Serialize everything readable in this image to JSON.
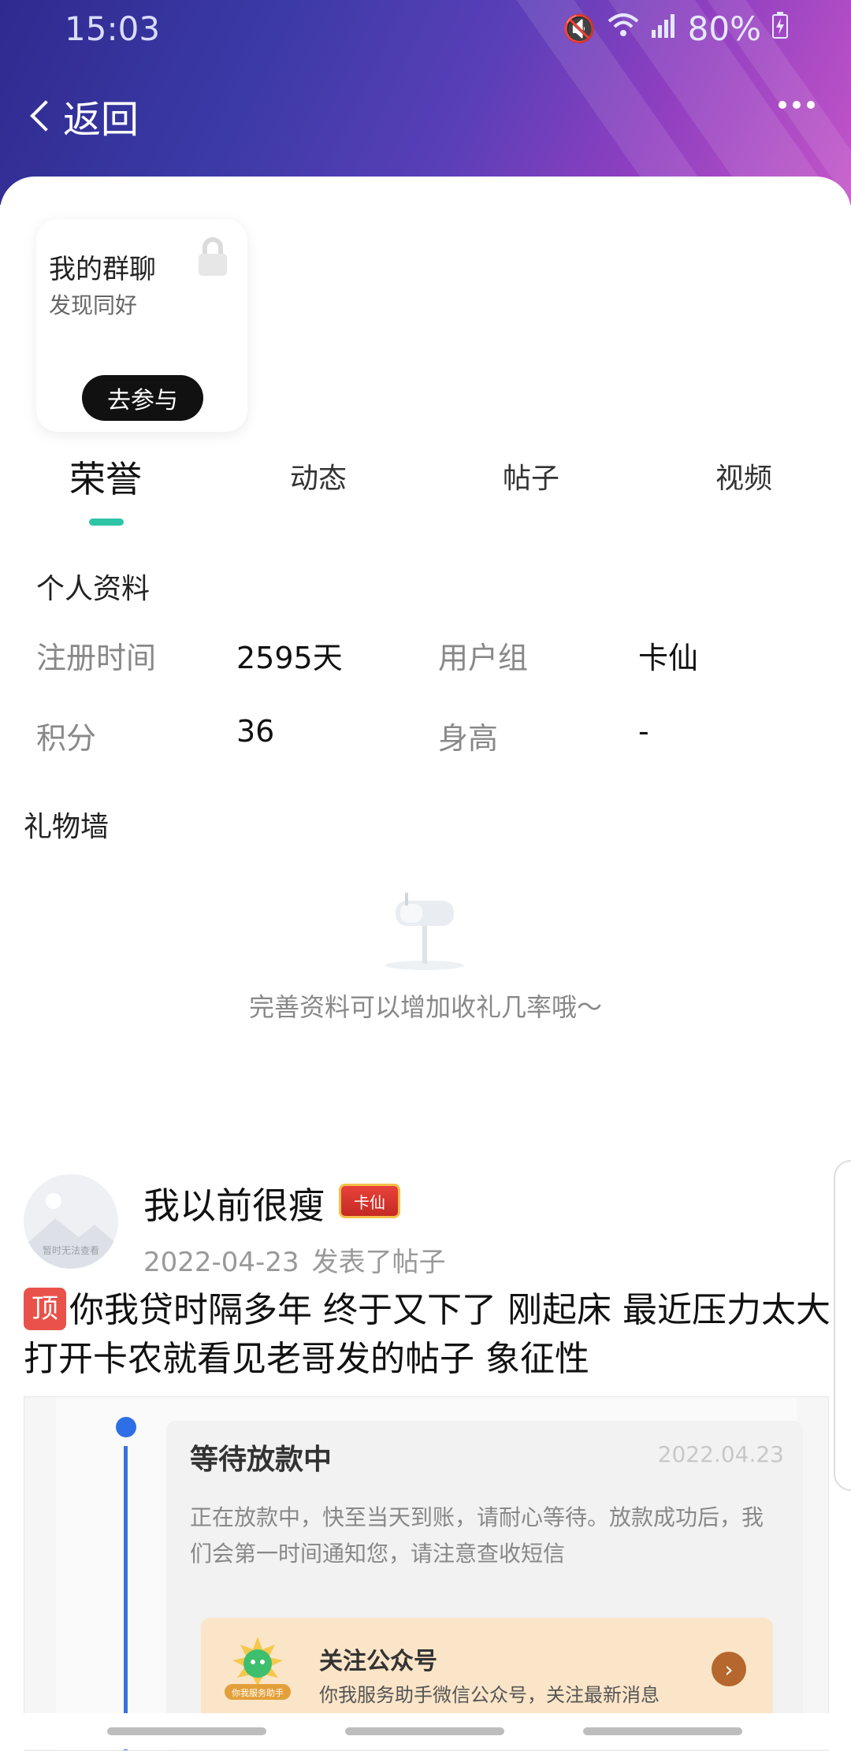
{
  "status_bar": {
    "time": "15:03",
    "battery": "80%",
    "icons": [
      "mute-icon",
      "wifi-icon",
      "signal-icon",
      "battery-charging-icon"
    ]
  },
  "header": {
    "back_label": "返回",
    "more_icon": "more-dots-icon"
  },
  "group_card": {
    "title": "我的群聊",
    "subtitle": "发现同好",
    "button": "去参与",
    "icon": "lock-icon"
  },
  "tabs": [
    {
      "label": "荣誉",
      "active": true
    },
    {
      "label": "动态",
      "active": false
    },
    {
      "label": "帖子",
      "active": false
    },
    {
      "label": "视频",
      "active": false
    }
  ],
  "profile": {
    "title": "个人资料",
    "rows": [
      {
        "label1": "注册时间",
        "value1": "2595天",
        "label2": "用户组",
        "value2": "卡仙"
      },
      {
        "label1": "积分",
        "value1": "36",
        "label2": "身高",
        "value2": "-"
      }
    ]
  },
  "gift_wall": {
    "title": "礼物墙",
    "empty_text": "完善资料可以增加收礼几率哦～",
    "icon": "mailbox-icon"
  },
  "post": {
    "avatar_text": "暂时无法查看",
    "author": "我以前很瘦",
    "badge": "卡仙",
    "date": "2022-04-23",
    "action": "发表了帖子",
    "pin": "顶",
    "text": "你我贷时隔多年 终于又下了 刚起床 最近压力太大 打开卡农就看见老哥发的帖子 象征性",
    "image": {
      "title": "等待放款中",
      "date": "2022.04.23",
      "desc": "正在放款中，快至当天到账，请耐心等待。放款成功后，我们会第一时间通知您，请注意查收短信",
      "follow_title": "关注公众号",
      "follow_sub": "你我服务助手微信公众号，关注最新消息",
      "logo_text": "你我服务助手"
    }
  },
  "colors": {
    "tab_accent": "#2ec4a6",
    "pin_tag": "#e9524a",
    "timeline": "#2f6fe6",
    "header_gradient_start": "#2f2a8f",
    "header_gradient_end": "#c455c8"
  }
}
